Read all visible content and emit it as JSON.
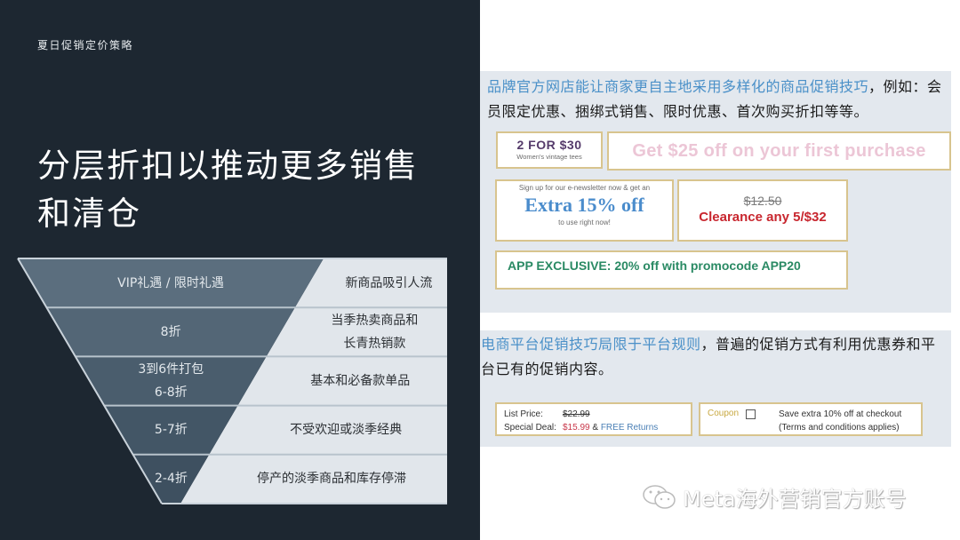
{
  "slide": {
    "eyebrow": "夏日促销定价策略",
    "title": "分层折扣以推动更多销售和清仓"
  },
  "funnel": {
    "tiers": [
      {
        "discount_lines": [
          "VIP礼遇 / 限时礼遇"
        ],
        "description_lines": [
          "新商品吸引人流"
        ]
      },
      {
        "discount_lines": [
          "8折"
        ],
        "description_lines": [
          "当季热卖商品和",
          "长青热销款"
        ]
      },
      {
        "discount_lines": [
          "3到6件打包",
          "6-8折"
        ],
        "description_lines": [
          "基本和必备款单品"
        ]
      },
      {
        "discount_lines": [
          "5-7折"
        ],
        "description_lines": [
          "不受欢迎或淡季经典"
        ]
      },
      {
        "discount_lines": [
          "2-4折"
        ],
        "description_lines": [
          "停产的淡季商品和库存停滞"
        ]
      }
    ],
    "colors": [
      "#5b6e7e",
      "#536676",
      "#4a5d6d",
      "#435666",
      "#3e5060"
    ]
  },
  "brand_store": {
    "highlight": "品牌官方网店能让商家更自主地采用多样化的商品促销技巧",
    "rest": "，例如：会员限定优惠、捆绑式销售、限时优惠、首次购买折扣等等。",
    "promos": {
      "two_for": {
        "headline": "2 FOR $30",
        "subline": "Women's vintage tees"
      },
      "first_purchase": {
        "headline": "Get $25 off on your first purchase"
      },
      "newsletter": {
        "top": "Sign up for our e-newsletter now & get an",
        "headline": "Extra 15% off",
        "bottom": "to use right now!"
      },
      "clearance": {
        "old_price": "$12.50",
        "headline": "Clearance any 5/$32"
      },
      "app": {
        "headline": "APP EXCLUSIVE: 20% off with promocode APP20"
      }
    }
  },
  "platform": {
    "highlight": "电商平台促销技巧局限于平台规则",
    "rest": "，普遍的促销方式有利用优惠券和平台已有的促销内容。",
    "price_box": {
      "list_label": "List Price:",
      "list_value": "$22.99",
      "deal_label": "Special Deal:",
      "deal_value": "$15.99",
      "deal_join": " & ",
      "deal_extra": "FREE Returns"
    },
    "coupon_box": {
      "label": "Coupon",
      "checked": false,
      "line1": "Save extra 10% off at checkout",
      "line2": "(Terms and conditions applies)"
    }
  },
  "watermark": {
    "text": "Meta海外营销官方账号",
    "icon": "wechat-icon"
  }
}
